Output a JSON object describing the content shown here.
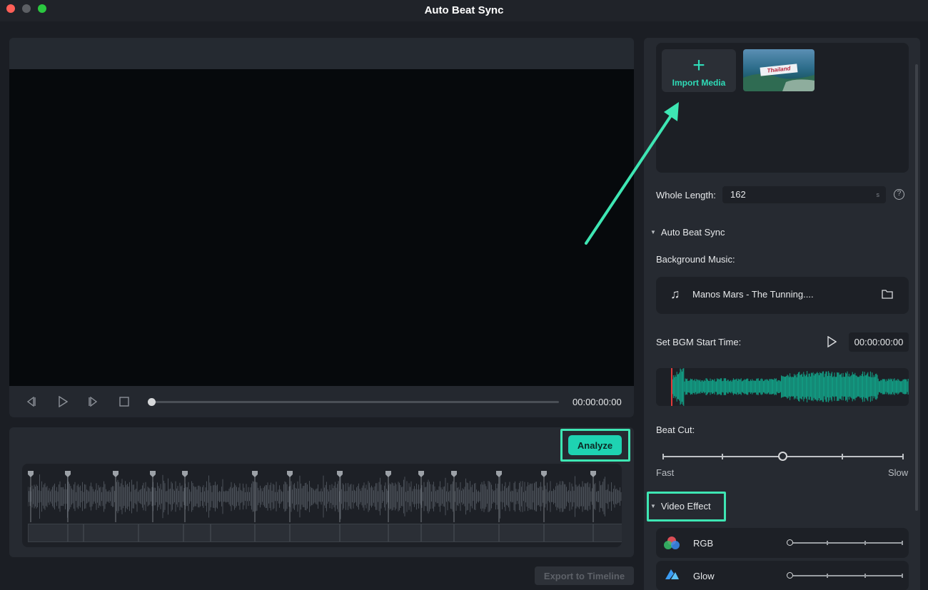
{
  "window": {
    "title": "Auto Beat Sync"
  },
  "preview": {
    "timecode": "00:00:00:00",
    "progress": 0
  },
  "analyze": {
    "button_label": "Analyze"
  },
  "export": {
    "button_label": "Export to Timeline"
  },
  "media": {
    "import_label": "Import Media",
    "import_icon": "plus-icon",
    "thumbnail_caption": "Thailand"
  },
  "whole_length": {
    "label": "Whole Length:",
    "value": "162",
    "unit": "s"
  },
  "auto_beat_sync": {
    "section_label": "Auto Beat Sync",
    "background_music_label": "Background Music:",
    "music_name": "Manos Mars - The Tunning....",
    "bgm_start_label": "Set BGM Start Time:",
    "bgm_start_time": "00:00:00:00",
    "beat_cut_label": "Beat Cut:",
    "beat_cut_min_label": "Fast",
    "beat_cut_max_label": "Slow",
    "beat_cut_level": 0.5
  },
  "video_effect": {
    "section_label": "Video Effect",
    "items": [
      {
        "name": "RGB",
        "icon": "rgb-circles-icon",
        "level": 0
      },
      {
        "name": "Glow",
        "icon": "glow-icon",
        "level": 0
      }
    ]
  },
  "colors": {
    "accent": "#1ed3b2",
    "highlight": "#3ee6b3",
    "waveform": "#12a58a",
    "playhead": "#e23a3a"
  }
}
